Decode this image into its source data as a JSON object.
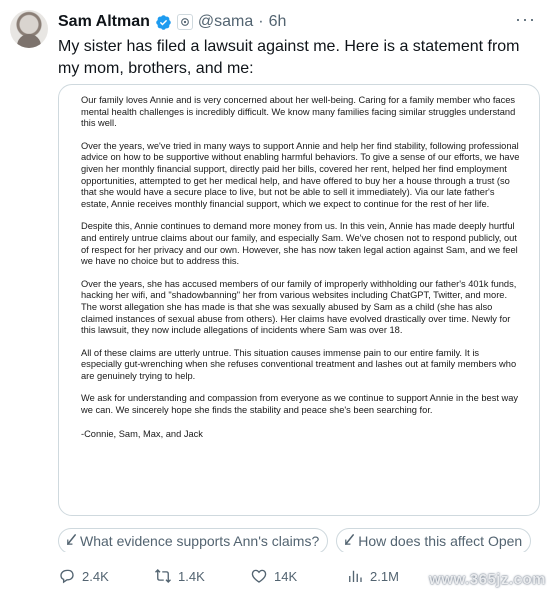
{
  "author": {
    "name": "Sam Altman",
    "handle": "@sama",
    "separator": "·",
    "time": "6h"
  },
  "icons": {
    "verified": "verified-badge-icon",
    "affiliation": "openai-affiliation-icon",
    "more": "more-options-icon"
  },
  "tweet": {
    "text": "My sister has filed a lawsuit against me. Here is a statement from my mom, brothers, and me:"
  },
  "statement": {
    "paragraphs": [
      "Our family loves Annie and is very concerned about her well-being. Caring for a family member who faces mental health challenges is incredibly difficult. We know many families facing similar struggles understand this well.",
      "Over the years, we've tried in many ways to support Annie and help her find stability, following professional advice on how to be supportive without enabling harmful behaviors. To give a sense of our efforts, we have given her monthly financial support, directly paid her bills, covered her rent, helped her find employment opportunities, attempted to get her medical help, and have offered to buy her a house through a trust (so that she would have a secure place to live, but not be able to sell it immediately). Via our late father's estate, Annie receives monthly financial support, which we expect to continue for the rest of her life.",
      "Despite this, Annie continues to demand more money from us. In this vein, Annie has made deeply hurtful and entirely untrue claims about our family, and especially Sam. We've chosen not to respond publicly, out of respect for her privacy and our own. However, she has now taken legal action against Sam, and we feel we have no choice but to address this.",
      "Over the years, she has accused members of our family of improperly withholding our father's 401k funds, hacking her wifi, and \"shadowbanning\" her from various websites including ChatGPT, Twitter, and more. The worst allegation she has made is that she was sexually abused by Sam as a child (she has also claimed instances of sexual abuse from others). Her claims have evolved drastically over time. Newly for this lawsuit, they now include allegations of incidents where Sam was over 18.",
      "All of these claims are utterly untrue. This situation causes immense pain to our entire family. It is especially gut-wrenching when she refuses conventional treatment and lashes out at family members who are genuinely trying to help.",
      "We ask for understanding and compassion from everyone as we continue to support Annie in the best way we can. We sincerely hope she finds the stability and peace she's been searching for."
    ],
    "signature": "-Connie, Sam, Max, and Jack"
  },
  "suggestions": [
    {
      "icon": "grok-spark-icon",
      "label": "What evidence supports Ann's claims?"
    },
    {
      "icon": "grok-spark-icon",
      "label": "How does this affect Open"
    }
  ],
  "actions": {
    "replies": "2.4K",
    "reposts": "1.4K",
    "likes": "14K",
    "views": "2.1M"
  },
  "watermark": "www.365jz.com"
}
